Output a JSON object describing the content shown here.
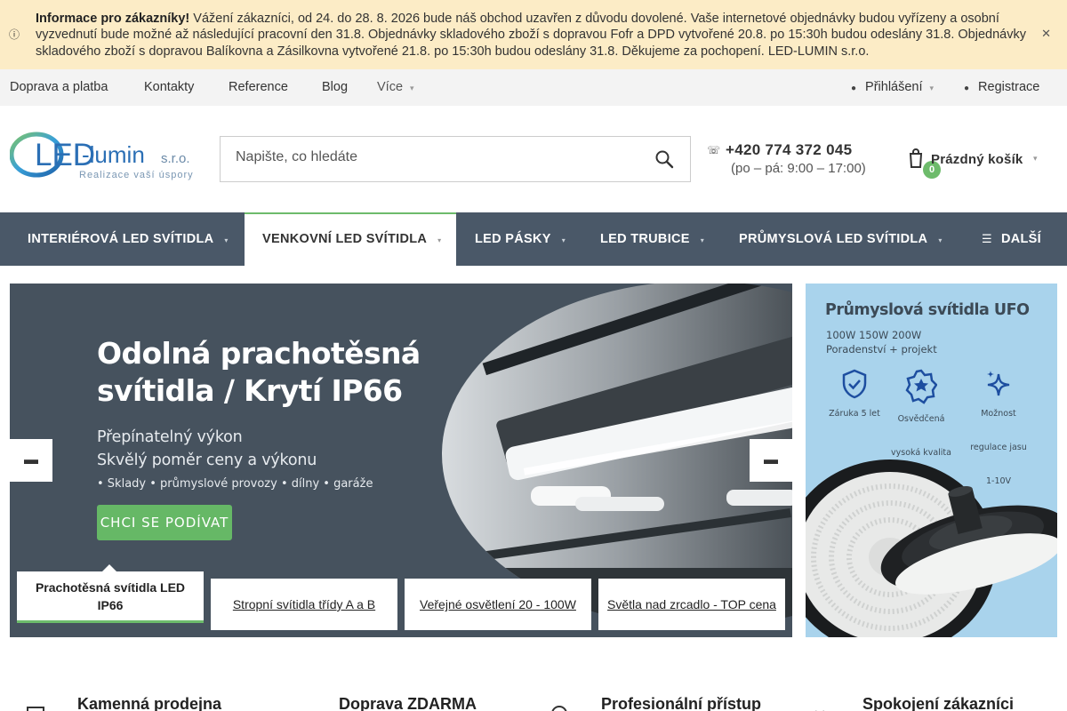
{
  "notice": {
    "title": "Informace pro zákazníky!",
    "text": " Vážení zákazníci, od 24. do 28. 8. 2026 bude náš obchod uzavřen z důvodu dovolené. Vaše internetové objednávky budou vyřízeny a osobní vyzvednutí bude možné až následující pracovní den 31.8. Objednávky skladového zboží s dopravou Fofr a DPD vytvořené 20.8. po 15:30h budou odeslány 31.8. Objednávky skladového zboží s dopravou Balíkovna a Zásilkovna vytvořené 21.8. po 15:30h budou odeslány 31.8. Děkujeme za pochopení. LED-LUMIN s.r.o."
  },
  "topbar": {
    "links": [
      "Doprava a platba",
      "Kontakty",
      "Reference",
      "Blog"
    ],
    "more": "Více",
    "login": "Přihlášení",
    "register": "Registrace"
  },
  "header": {
    "logo_text": "LED",
    "logo_text2": "-lumin",
    "logo_suffix": "s.r.o.",
    "logo_tagline": "Realizace vaší úspory",
    "search_placeholder": "Napište, co hledáte",
    "phone": "+420 774 372 045",
    "hours": "(po – pá: 9:00 – 17:00)",
    "cart_count": "0",
    "cart_label": "Prázdný košík"
  },
  "nav": {
    "items": [
      "INTERIÉROVÁ LED SVÍTIDLA",
      "VENKOVNÍ LED SVÍTIDLA",
      "LED PÁSKY",
      "LED TRUBICE",
      "PRŮMYSLOVÁ LED SVÍTIDLA"
    ],
    "more": "DALŠÍ"
  },
  "hero": {
    "title": "Odolná prachotěsná svítidla / Krytí IP66",
    "subtitle1": "Přepínatelný výkon",
    "subtitle2": "Skvělý poměr ceny a výkonu",
    "bullets": "• Sklady • průmyslové provozy • dílny • garáže",
    "cta": "CHCI SE PODÍVAT",
    "tabs": [
      "Prachotěsná svítidla LED IP66",
      "Stropní svítidla třídy A a B",
      "Veřejné osvětlení 20 - 100W",
      "Světla nad zrcadlo - TOP cena"
    ]
  },
  "side_banner": {
    "title": "Průmyslová svítidla UFO",
    "line1": "100W 150W 200W",
    "line2": "Poradenství + projekt",
    "features": [
      {
        "line1": "Záruka 5 let",
        "line2": ""
      },
      {
        "line1": "Osvědčená",
        "line2": "vysoká kvalita"
      },
      {
        "line1": "Možnost",
        "line2": "regulace jasu",
        "line3": "1-10V"
      }
    ]
  },
  "benefits": [
    "Kamenná prodejna",
    "Doprava ZDARMA",
    "Profesionální přístup",
    "Spokojení zákazníci"
  ],
  "icons": {
    "notice": "info-icon",
    "close": "close-icon",
    "login": "user-icon",
    "register": "user-add-icon",
    "search": "search-icon",
    "phone": "phone-icon",
    "cart": "cart-icon",
    "nav_more": "menu-icon",
    "arrow_prev": "arrow-left-icon",
    "arrow_next": "arrow-right-icon"
  },
  "colors": {
    "notice_bg": "#fcecc6",
    "nav_bg": "#4a5868",
    "accent_green": "#6dbb6b",
    "hero_bg": "#46525e",
    "side_bg": "#a9d3ec"
  }
}
